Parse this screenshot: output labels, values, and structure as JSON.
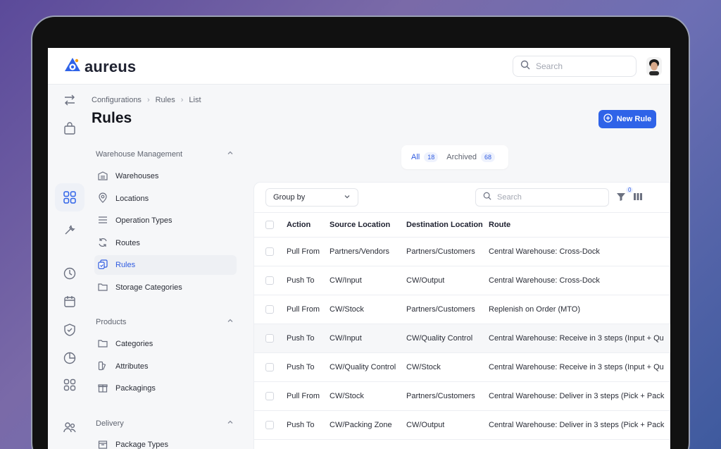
{
  "app": {
    "brand": "aureus"
  },
  "search": {
    "placeholder": "Search"
  },
  "breadcrumb": [
    "Configurations",
    "Rules",
    "List"
  ],
  "page": {
    "title": "Rules",
    "new_button": "New Rule"
  },
  "filters": {
    "all_label": "All",
    "all_count": "18",
    "archived_label": "Archived",
    "archived_count": "68"
  },
  "sidebar": {
    "groups": [
      {
        "title": "Warehouse Management",
        "items": [
          {
            "label": "Warehouses",
            "icon": "warehouse-icon"
          },
          {
            "label": "Locations",
            "icon": "location-pin-icon"
          },
          {
            "label": "Operation Types",
            "icon": "list-icon"
          },
          {
            "label": "Routes",
            "icon": "routes-icon"
          },
          {
            "label": "Rules",
            "icon": "rules-icon",
            "active": true
          },
          {
            "label": "Storage Categories",
            "icon": "folder-icon"
          }
        ]
      },
      {
        "title": "Products",
        "items": [
          {
            "label": "Categories",
            "icon": "folder-icon"
          },
          {
            "label": "Attributes",
            "icon": "attributes-icon"
          },
          {
            "label": "Packagings",
            "icon": "gift-icon"
          }
        ]
      },
      {
        "title": "Delivery",
        "items": [
          {
            "label": "Package Types",
            "icon": "package-icon"
          }
        ]
      }
    ]
  },
  "toolbar": {
    "group_by": "Group by",
    "search_placeholder": "Search",
    "filter_count": "0"
  },
  "table": {
    "columns": [
      "Action",
      "Source Location",
      "Destination Location",
      "Route"
    ],
    "rows": [
      [
        "Pull From",
        "Partners/Vendors",
        "Partners/Customers",
        "Central Warehouse: Cross-Dock"
      ],
      [
        "Push To",
        "CW/Input",
        "CW/Output",
        "Central Warehouse: Cross-Dock"
      ],
      [
        "Pull From",
        "CW/Stock",
        "Partners/Customers",
        "Replenish on Order (MTO)"
      ],
      [
        "Push To",
        "CW/Input",
        "CW/Quality Control",
        "Central Warehouse: Receive in 3 steps (Input + Qu"
      ],
      [
        "Push To",
        "CW/Quality Control",
        "CW/Stock",
        "Central Warehouse: Receive in 3 steps (Input + Qu"
      ],
      [
        "Pull From",
        "CW/Stock",
        "Partners/Customers",
        "Central Warehouse: Deliver in 3 steps (Pick + Pack"
      ],
      [
        "Push To",
        "CW/Packing Zone",
        "CW/Output",
        "Central Warehouse: Deliver in 3 steps (Pick + Pack"
      ]
    ]
  },
  "colors": {
    "accent": "#2f63e8",
    "text": "#2a2d37",
    "muted": "#5f6470"
  }
}
